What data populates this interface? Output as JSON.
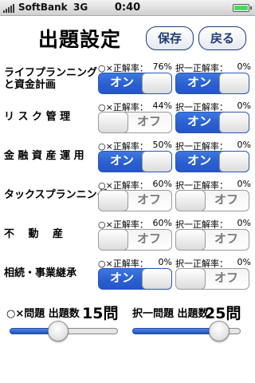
{
  "status_bar": {
    "carrier": "SoftBank",
    "network": "3G",
    "time": "0:40"
  },
  "page": {
    "title": "出題設定",
    "save_label": "保存",
    "back_label": "戻る"
  },
  "switch_labels": {
    "on": "オン",
    "off": "オフ"
  },
  "categories": [
    {
      "name": "ライフプランニング\nと資金計画",
      "ox_label": "○×正解率：",
      "ox_rate": "76%",
      "ox_on": true,
      "choice_label": "択一正解率：",
      "choice_rate": "0%",
      "choice_on": true
    },
    {
      "name": "リ ス ク 管 理",
      "ox_label": "○×正解率：",
      "ox_rate": "44%",
      "ox_on": false,
      "choice_label": "択一正解率：",
      "choice_rate": "0%",
      "choice_on": true
    },
    {
      "name": "金 融 資 産 運 用",
      "ox_label": "○×正解率：",
      "ox_rate": "50%",
      "ox_on": true,
      "choice_label": "択一正解率：",
      "choice_rate": "0%",
      "choice_on": true
    },
    {
      "name": "タックスプランニング",
      "ox_label": "○×正解率：",
      "ox_rate": "60%",
      "ox_on": false,
      "choice_label": "択一正解率：",
      "choice_rate": "0%",
      "choice_on": false
    },
    {
      "name": "不　 動　 産",
      "ox_label": "○×正解率：",
      "ox_rate": "60%",
      "ox_on": false,
      "choice_label": "択一正解率：",
      "choice_rate": "0%",
      "choice_on": false
    },
    {
      "name": "相続・事業継承",
      "ox_label": "○×正解率：",
      "ox_rate": "0%",
      "ox_on": true,
      "choice_label": "択一正解率：",
      "choice_rate": "0%",
      "choice_on": false
    }
  ],
  "question_counts": {
    "ox_label": "○×問題 出題数",
    "ox_value": "15問",
    "ox_slider_fraction": 0.45,
    "choice_label": "択一問題 出題数",
    "choice_value": "25問",
    "choice_slider_fraction": 0.8
  },
  "colors": {
    "switch_on": "#2a5fd0",
    "nav_button": "#1f3c7a",
    "battery": "#4cd864"
  }
}
